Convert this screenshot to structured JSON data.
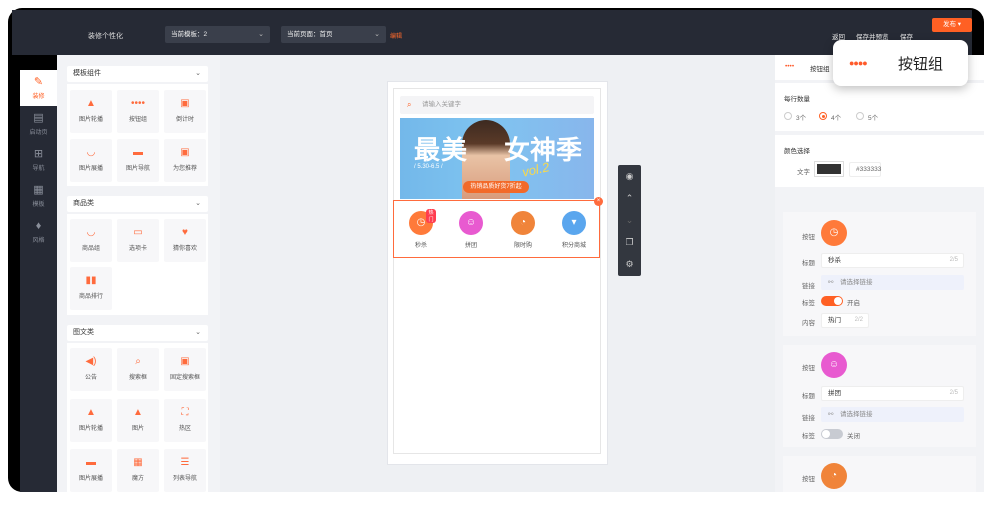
{
  "topbar": {
    "brand": "装修个性化",
    "template_select": "当前模板：2",
    "page_select": "当前页面：首页",
    "edit_link": "编辑",
    "back": "返回",
    "save_preview": "保存并预览",
    "save": "保存",
    "publish": "发布"
  },
  "rail": [
    {
      "label": "装修",
      "icon": "brush-icon"
    },
    {
      "label": "启动页",
      "icon": "page-icon"
    },
    {
      "label": "导航",
      "icon": "grid-icon"
    },
    {
      "label": "模板",
      "icon": "template-icon"
    },
    {
      "label": "风格",
      "icon": "style-icon"
    }
  ],
  "sections": {
    "template": {
      "title": "模板组件",
      "tiles": [
        "图片轮播",
        "按钮组",
        "倒计时",
        "图片展播",
        "图片导航",
        "为您推荐"
      ]
    },
    "goods": {
      "title": "商品类",
      "tiles": [
        "商品组",
        "选项卡",
        "猜你喜欢",
        "商品排行"
      ]
    },
    "graphic": {
      "title": "图文类",
      "tiles": [
        "公告",
        "搜索框",
        "固定搜索框",
        "图片轮播",
        "图片",
        "热区",
        "图片展播",
        "魔方",
        "列表导航"
      ]
    }
  },
  "phone": {
    "search_placeholder": "请输入关键字",
    "banner_title_left": "最美",
    "banner_title_right": "女神季",
    "banner_date": "/ 5.30-6.5 /",
    "banner_script": "vol.2",
    "banner_tag": "热销品质好货7折起",
    "buttons": [
      {
        "label": "秒杀",
        "color": "#ff7a3a",
        "badge": "热门"
      },
      {
        "label": "拼团",
        "color": "#e85ad0",
        "badge": ""
      },
      {
        "label": "限时购",
        "color": "#f0843a",
        "badge": ""
      },
      {
        "label": "积分商城",
        "color": "#5aa6ee",
        "badge": ""
      }
    ]
  },
  "right": {
    "header": "按钮组",
    "per_row_label": "每行数量",
    "per_row_options": [
      "3个",
      "4个",
      "5个"
    ],
    "per_row_selected": "4个",
    "color_section": "颜色选择",
    "text_label": "文字",
    "text_color": "#333333",
    "cards": [
      {
        "button_label": "按钮",
        "title_label": "标题",
        "title_value": "秒杀",
        "title_count": "2/5",
        "link_label": "链接",
        "link_placeholder": "请选择链接",
        "tag_label": "标签",
        "tag_state": "开启",
        "content_label": "内容",
        "content_value": "热门",
        "content_count": "2/2"
      },
      {
        "button_label": "按钮",
        "title_label": "标题",
        "title_value": "拼团",
        "title_count": "2/5",
        "link_label": "链接",
        "link_placeholder": "请选择链接",
        "tag_label": "标签",
        "tag_state": "关闭"
      },
      {
        "button_label": "按钮"
      }
    ]
  },
  "tooltip": {
    "text": "按钮组"
  }
}
